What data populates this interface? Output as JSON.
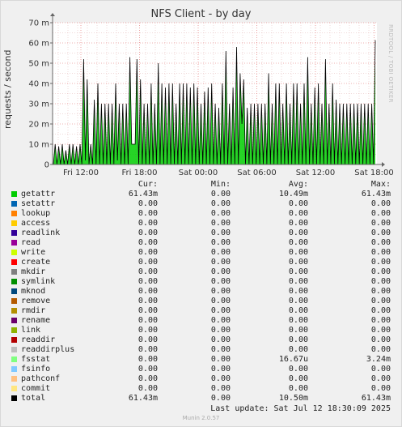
{
  "title": "NFS Client - by day",
  "watermark": "RRDTOOL / TOBI OETIKER",
  "chart_data": {
    "type": "line",
    "title": "NFS Client - by day",
    "ylabel": "requests / second",
    "ylim": [
      0,
      70
    ],
    "yticks": [
      "0",
      "10 m",
      "20 m",
      "30 m",
      "40 m",
      "50 m",
      "60 m",
      "70 m"
    ],
    "xticks": [
      "Fri 12:00",
      "Fri 18:00",
      "Sat 00:00",
      "Sat 06:00",
      "Sat 12:00",
      "Sat 18:00"
    ],
    "grid": true,
    "series": [
      {
        "name": "getattr",
        "values": [
          0,
          10,
          0,
          9,
          0,
          10,
          0,
          7,
          0,
          10,
          0,
          10,
          0,
          9,
          0,
          10,
          0,
          52,
          2,
          42,
          0,
          10,
          0,
          32,
          0,
          40,
          0,
          30,
          0,
          30,
          0,
          30,
          0,
          30,
          0,
          40,
          2,
          30,
          0,
          30,
          0,
          30,
          0,
          53,
          10,
          10,
          10,
          52,
          0,
          42,
          0,
          30,
          0,
          30,
          0,
          40,
          0,
          30,
          0,
          50,
          0,
          40,
          0,
          38,
          0,
          40,
          0,
          40,
          0,
          30,
          0,
          40,
          0,
          40,
          0,
          40,
          0,
          38,
          0,
          40,
          0,
          38,
          0,
          30,
          0,
          36,
          0,
          38,
          0,
          40,
          0,
          30,
          0,
          28,
          0,
          40,
          0,
          56,
          0,
          30,
          0,
          38,
          0,
          58,
          0,
          45,
          20,
          42,
          0,
          28,
          0,
          30,
          0,
          30,
          0,
          30,
          0,
          30,
          0,
          30,
          0,
          45,
          0,
          30,
          0,
          40,
          0,
          40,
          0,
          30,
          0,
          40,
          0,
          30,
          0,
          40,
          0,
          40,
          0,
          30,
          0,
          40,
          0,
          53,
          0,
          30,
          0,
          38,
          0,
          40,
          0,
          30,
          0,
          52,
          0,
          30,
          0,
          40,
          0,
          32,
          0,
          30,
          0,
          30,
          0,
          30,
          0,
          30,
          0,
          30,
          0,
          30,
          0,
          30,
          0,
          30,
          0,
          30,
          0,
          30,
          0,
          61.4
        ],
        "color": "#00cc00"
      }
    ]
  },
  "legend": {
    "headers": [
      "Cur:",
      "Min:",
      "Avg:",
      "Max:"
    ],
    "rows": [
      {
        "name": "getattr",
        "color": "#00cc00",
        "cur": "61.43m",
        "min": "0.00",
        "avg": "10.49m",
        "max": "61.43m"
      },
      {
        "name": "setattr",
        "color": "#0066b3",
        "cur": "0.00",
        "min": "0.00",
        "avg": "0.00",
        "max": "0.00"
      },
      {
        "name": "lookup",
        "color": "#ff8000",
        "cur": "0.00",
        "min": "0.00",
        "avg": "0.00",
        "max": "0.00"
      },
      {
        "name": "access",
        "color": "#ffcc00",
        "cur": "0.00",
        "min": "0.00",
        "avg": "0.00",
        "max": "0.00"
      },
      {
        "name": "readlink",
        "color": "#330099",
        "cur": "0.00",
        "min": "0.00",
        "avg": "0.00",
        "max": "0.00"
      },
      {
        "name": "read",
        "color": "#990099",
        "cur": "0.00",
        "min": "0.00",
        "avg": "0.00",
        "max": "0.00"
      },
      {
        "name": "write",
        "color": "#ccff00",
        "cur": "0.00",
        "min": "0.00",
        "avg": "0.00",
        "max": "0.00"
      },
      {
        "name": "create",
        "color": "#ff0000",
        "cur": "0.00",
        "min": "0.00",
        "avg": "0.00",
        "max": "0.00"
      },
      {
        "name": "mkdir",
        "color": "#808080",
        "cur": "0.00",
        "min": "0.00",
        "avg": "0.00",
        "max": "0.00"
      },
      {
        "name": "symlink",
        "color": "#008f00",
        "cur": "0.00",
        "min": "0.00",
        "avg": "0.00",
        "max": "0.00"
      },
      {
        "name": "mknod",
        "color": "#00487d",
        "cur": "0.00",
        "min": "0.00",
        "avg": "0.00",
        "max": "0.00"
      },
      {
        "name": "remove",
        "color": "#b35a00",
        "cur": "0.00",
        "min": "0.00",
        "avg": "0.00",
        "max": "0.00"
      },
      {
        "name": "rmdir",
        "color": "#b38f00",
        "cur": "0.00",
        "min": "0.00",
        "avg": "0.00",
        "max": "0.00"
      },
      {
        "name": "rename",
        "color": "#6b006b",
        "cur": "0.00",
        "min": "0.00",
        "avg": "0.00",
        "max": "0.00"
      },
      {
        "name": "link",
        "color": "#8fb300",
        "cur": "0.00",
        "min": "0.00",
        "avg": "0.00",
        "max": "0.00"
      },
      {
        "name": "readdir",
        "color": "#b30000",
        "cur": "0.00",
        "min": "0.00",
        "avg": "0.00",
        "max": "0.00"
      },
      {
        "name": "readdirplus",
        "color": "#bebebe",
        "cur": "0.00",
        "min": "0.00",
        "avg": "0.00",
        "max": "0.00"
      },
      {
        "name": "fsstat",
        "color": "#80ff80",
        "cur": "0.00",
        "min": "0.00",
        "avg": "16.67u",
        "max": "3.24m"
      },
      {
        "name": "fsinfo",
        "color": "#80c9ff",
        "cur": "0.00",
        "min": "0.00",
        "avg": "0.00",
        "max": "0.00"
      },
      {
        "name": "pathconf",
        "color": "#ffc080",
        "cur": "0.00",
        "min": "0.00",
        "avg": "0.00",
        "max": "0.00"
      },
      {
        "name": "commit",
        "color": "#ffe680",
        "cur": "0.00",
        "min": "0.00",
        "avg": "0.00",
        "max": "0.00"
      },
      {
        "name": "total",
        "color": "#000000",
        "cur": "61.43m",
        "min": "0.00",
        "avg": "10.50m",
        "max": "61.43m"
      }
    ]
  },
  "last_update": "Last update: Sat Jul 12 18:30:09 2025",
  "footer": "Munin 2.0.57"
}
